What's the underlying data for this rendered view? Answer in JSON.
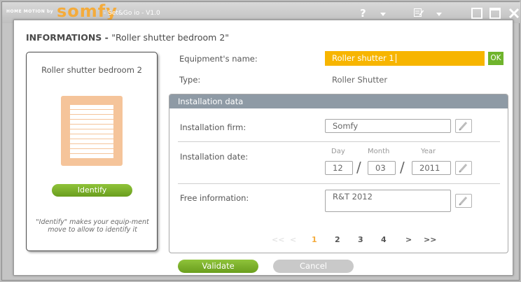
{
  "titlebar": {
    "brand_prefix": "HOME MOTION by",
    "brand_logo": "somfy",
    "version": "- Set&Go io - V1.0",
    "help_label": "?",
    "icons": [
      "help-icon",
      "caret-down-icon",
      "edit-notes-icon",
      "minimize-icon",
      "maximize-icon",
      "close-icon"
    ]
  },
  "dialog": {
    "title_prefix": "INFORMATIONS - ",
    "title_device": "\"Roller shutter bedroom 2\""
  },
  "card": {
    "device_name": "Roller shutter bedroom 2",
    "icon": "roller-shutter-icon",
    "identify_label": "Identify",
    "help_text": "\"Identify\" makes your equip-ment move to allow to identify it"
  },
  "equipment": {
    "name_label": "Equipment's name:",
    "name_value": "Roller shutter 1",
    "ok_label": "OK",
    "type_label": "Type:",
    "type_value": "Roller Shutter"
  },
  "installation": {
    "header": "Installation data",
    "firm_label": "Installation firm:",
    "firm_value": "Somfy",
    "date_label": "Installation date:",
    "day_caption": "Day",
    "month_caption": "Month",
    "year_caption": "Year",
    "day_value": "12",
    "month_value": "03",
    "year_value": "2011",
    "separator": "/",
    "free_label": "Free information:",
    "free_value": "R&T 2012"
  },
  "pager": {
    "first": "<<",
    "prev": "<",
    "pages": [
      "1",
      "2",
      "3",
      "4"
    ],
    "current": "1",
    "next": ">",
    "last": ">>"
  },
  "actions": {
    "validate_label": "Validate",
    "cancel_label": "Cancel"
  },
  "colors": {
    "accent_orange": "#f7b500",
    "brand_orange": "#f4ab3b",
    "green": "#7ab22d",
    "panel_header": "#8e9aa5"
  }
}
